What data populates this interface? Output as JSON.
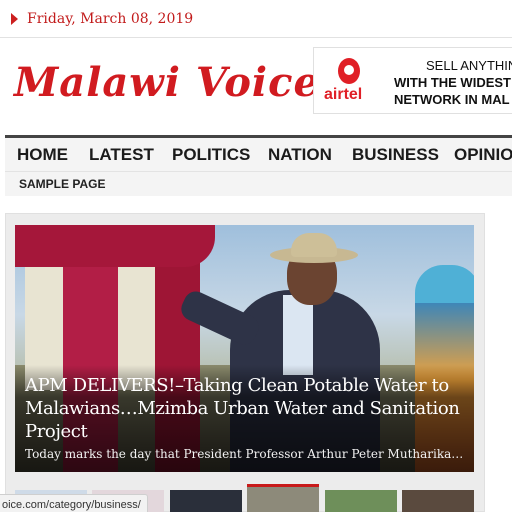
{
  "topbar": {
    "date": "Friday, March 08, 2019"
  },
  "site": {
    "logo_text": "Malawi Voice"
  },
  "ad": {
    "brand": "airtel",
    "lines": [
      "SELL ANYTHIN",
      "WITH THE WIDEST",
      "NETWORK IN MAL"
    ]
  },
  "nav": {
    "items": [
      "HOME",
      "LATEST",
      "POLITICS",
      "NATION",
      "BUSINESS",
      "OPINION"
    ],
    "subitems": [
      "SAMPLE PAGE"
    ]
  },
  "featured": {
    "headline": "APM DELIVERS!–Taking Clean Potable Water to Malawians…Mzimba Urban Water and Sanitation Project",
    "excerpt": "Today marks the day that President Professor Arthur Peter Mutharika…"
  },
  "statusbar": {
    "url": "oice.com/category/business/"
  },
  "colors": {
    "accent": "#cc1f1f",
    "nav_border": "#444444"
  }
}
